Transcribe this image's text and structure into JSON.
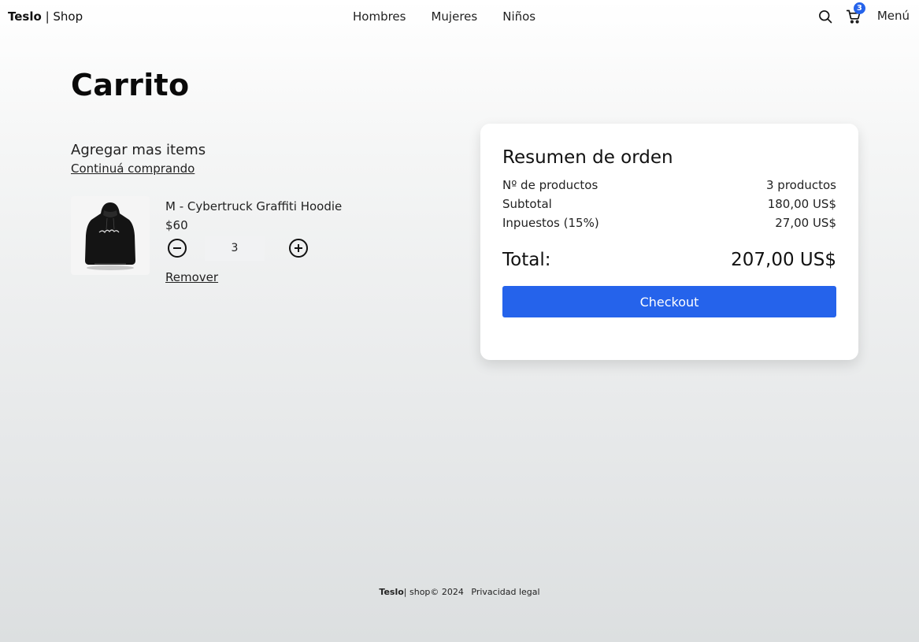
{
  "header": {
    "brand_bold": "Teslo",
    "brand_rest": " | Shop",
    "nav": [
      "Hombres",
      "Mujeres",
      "Niños"
    ],
    "cart_count": "3",
    "menu_label": "Menú"
  },
  "page": {
    "title": "Carrito",
    "add_items": "Agregar mas items",
    "continue_link": "Continuá comprando"
  },
  "cart_items": [
    {
      "title": "M - Cybertruck Graffiti Hoodie",
      "price": "$60",
      "quantity": "3",
      "remove_label": "Remover"
    }
  ],
  "summary": {
    "title": "Resumen de orden",
    "rows": [
      {
        "label": "Nº de productos",
        "value": "3 productos"
      },
      {
        "label": "Subtotal",
        "value": "180,00 US$"
      },
      {
        "label": "Inpuestos (15%)",
        "value": "27,00 US$"
      }
    ],
    "total_label": "Total:",
    "total_value": "207,00 US$",
    "checkout_label": "Checkout"
  },
  "footer": {
    "brand": "Teslo",
    "text": "| shop© 2024",
    "legal": "Privacidad legal"
  },
  "colors": {
    "accent": "#2563eb"
  }
}
